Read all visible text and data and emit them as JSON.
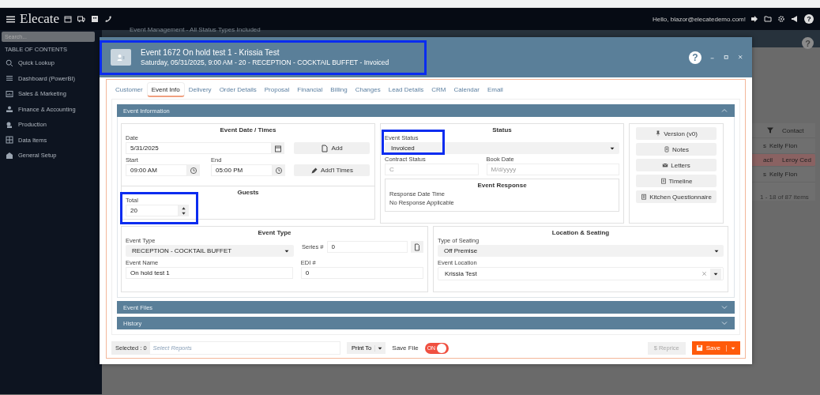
{
  "topbar": {
    "logo": "Elecate",
    "help": "?",
    "greeting": "Hello, blazor@elecatedemo.com!"
  },
  "sidebar": {
    "search_placeholder": "Search...",
    "heading": "TABLE OF CONTENTS",
    "items": [
      {
        "label": "Quick Lookup"
      },
      {
        "label": "Dashboard (PowerBI)"
      },
      {
        "label": "Sales & Marketing"
      },
      {
        "label": "Finance & Accounting"
      },
      {
        "label": "Production"
      },
      {
        "label": "Data Items"
      },
      {
        "label": "General Setup"
      }
    ]
  },
  "background_page": {
    "title": "Event Management - All Status Types Included",
    "help": "?",
    "column_header": "Contact",
    "rows": [
      {
        "column_1": "s",
        "contact": "Kelly Flon",
        "selected": false
      },
      {
        "column_1": "acil",
        "contact": "Leroy Ced",
        "selected": true
      },
      {
        "column_1": "s",
        "contact": "Kelly Flon",
        "selected": false
      }
    ],
    "pager": "1 - 18 of 87 items"
  },
  "modal": {
    "title": "Event 1672 On hold test 1 - Krissia Test",
    "subtitle": "Saturday, 05/31/2025, 9:00 AM - 20 - RECEPTION - COCKTAIL BUFFET - Invoiced",
    "highlighted": true,
    "help": "?",
    "tabs": [
      {
        "label": "Customer",
        "selected": false
      },
      {
        "label": "Event Info",
        "selected": true
      },
      {
        "label": "Delivery",
        "selected": false
      },
      {
        "label": "Order Details",
        "selected": false
      },
      {
        "label": "Proposal",
        "selected": false
      },
      {
        "label": "Financial",
        "selected": false
      },
      {
        "label": "Billing",
        "selected": false
      },
      {
        "label": "Changes",
        "selected": false
      },
      {
        "label": "Lead Details",
        "selected": false
      },
      {
        "label": "CRM",
        "selected": false
      },
      {
        "label": "Calendar",
        "selected": false
      },
      {
        "label": "Email",
        "selected": false
      }
    ],
    "sections": [
      {
        "title": "Event Information",
        "expanded": true
      },
      {
        "title": "Event Files",
        "expanded": false
      },
      {
        "title": "History",
        "expanded": false
      }
    ],
    "event_dates": {
      "title": "Event Date / Times",
      "date": {
        "label": "Date",
        "value": "5/31/2025"
      },
      "start": {
        "label": "Start",
        "value": "09:00 AM"
      },
      "end": {
        "label": "End",
        "value": "05:00 PM"
      },
      "add_button": "Add",
      "times_button": "Add'l Times"
    },
    "guests": {
      "title": "Guests",
      "total": {
        "label": "Total",
        "value": "20",
        "highlighted": true
      }
    },
    "status": {
      "title": "Status",
      "event_status": {
        "label": "Event Status",
        "value": "Invoiced",
        "highlighted": true
      },
      "contract_status": {
        "label": "Contract Status",
        "placeholder": "C"
      },
      "book_date": {
        "label": "Book Date",
        "placeholder": "M/d/yyyy"
      },
      "response": {
        "title": "Event Response",
        "label": "Response Date Time",
        "value": "No Response Applicable"
      }
    },
    "side_buttons": [
      "Version (v0)",
      "Notes",
      "Letters",
      "Timeline",
      "Kitchen Questionnaire"
    ],
    "event_type": {
      "title": "Event Type",
      "type": {
        "label": "Event Type",
        "value": "RECEPTION - COCKTAIL BUFFET"
      },
      "series": {
        "label": "Series #",
        "value": "0"
      },
      "name": {
        "label": "Event Name",
        "value": "On hold test 1"
      },
      "edi": {
        "label": "EDI #",
        "value": "0"
      }
    },
    "location": {
      "title": "Location & Seating",
      "seating": {
        "label": "Type of Seating",
        "value": "Off Premise"
      },
      "location": {
        "label": "Event Location",
        "value": "Krissia Test"
      }
    },
    "footer": {
      "selected": "Selected : 0",
      "reports_placeholder": "Select Reports",
      "print_to": "Print To",
      "save_file": {
        "label": "Save File",
        "toggle_text": "ON",
        "on": true
      },
      "reprice": {
        "icon": "$",
        "label": "Reprice",
        "disabled": true
      },
      "save": "Save"
    }
  }
}
